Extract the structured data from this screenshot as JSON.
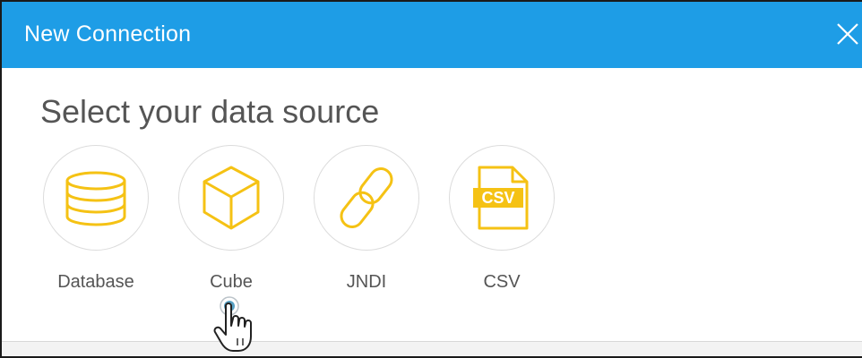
{
  "dialog": {
    "title": "New Connection",
    "close_icon": "close-icon"
  },
  "main": {
    "heading": "Select your data source",
    "sources": [
      {
        "label": "Database",
        "icon": "database-icon"
      },
      {
        "label": "Cube",
        "icon": "cube-icon"
      },
      {
        "label": "JNDI",
        "icon": "link-icon"
      },
      {
        "label": "CSV",
        "icon": "csv-file-icon"
      }
    ]
  },
  "csv_icon_text": "CSV",
  "colors": {
    "header": "#1e9de6",
    "icon_accent": "#f5c214",
    "text": "#555555"
  },
  "cursor": "pointer-hand-icon"
}
